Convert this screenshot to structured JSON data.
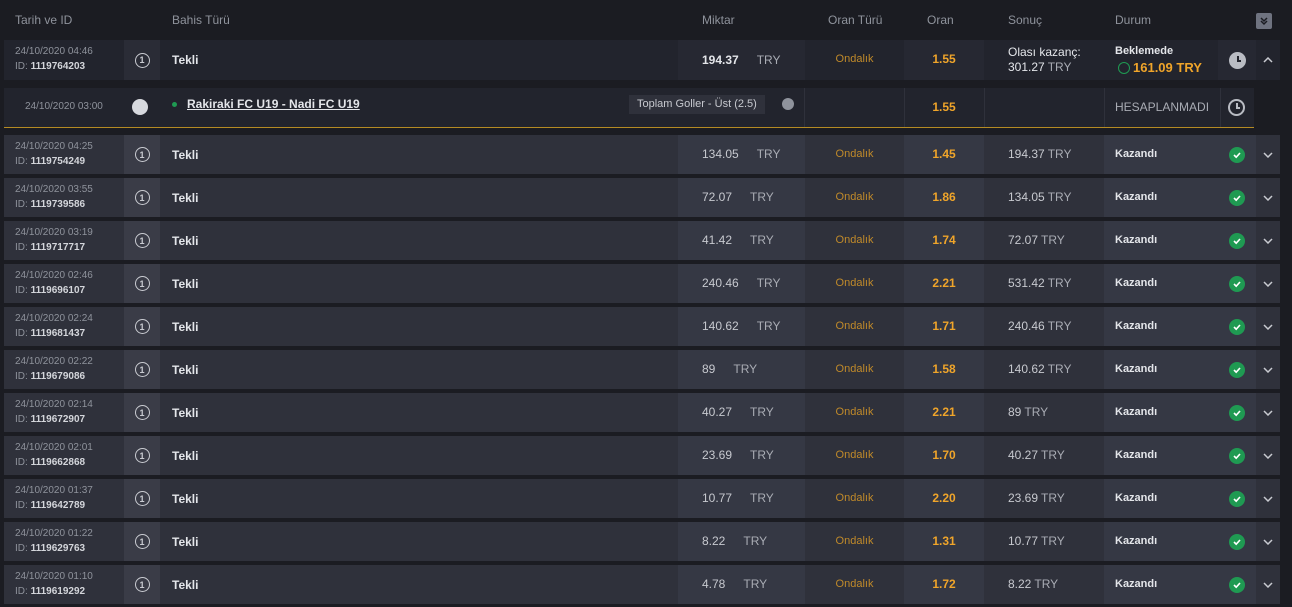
{
  "header": {
    "date_id": "Tarih ve ID",
    "bet_type": "Bahis Türü",
    "amount": "Miktar",
    "odds_type": "Oran Türü",
    "odds": "Oran",
    "result": "Sonuç",
    "status": "Durum"
  },
  "expanded_bet": {
    "date": "24/10/2020 04:46",
    "id_prefix": "ID:",
    "id": "1119764203",
    "type": "Tekli",
    "amount": "194.37",
    "currency": "TRY",
    "odds_type": "Ondalık",
    "odds": "1.55",
    "potential_label": "Olası kazanç:",
    "potential_amount": "301.27",
    "potential_currency": "TRY",
    "status": "Beklemede",
    "cashout": "161.09 TRY",
    "selection": {
      "date": "24/10/2020 03:00",
      "match": "Rakiraki FC U19 - Nadi FC U19",
      "market": "Toplam Goller - Üst (2.5)",
      "odds": "1.55",
      "status": "HESAPLANMADI"
    }
  },
  "bets": [
    {
      "date": "24/10/2020 04:25",
      "id": "1119754249",
      "type": "Tekli",
      "amount": "134.05",
      "currency": "TRY",
      "odds_type": "Ondalık",
      "odds": "1.45",
      "result": "194.37",
      "status": "Kazandı"
    },
    {
      "date": "24/10/2020 03:55",
      "id": "1119739586",
      "type": "Tekli",
      "amount": "72.07",
      "currency": "TRY",
      "odds_type": "Ondalık",
      "odds": "1.86",
      "result": "134.05",
      "status": "Kazandı"
    },
    {
      "date": "24/10/2020 03:19",
      "id": "1119717717",
      "type": "Tekli",
      "amount": "41.42",
      "currency": "TRY",
      "odds_type": "Ondalık",
      "odds": "1.74",
      "result": "72.07",
      "status": "Kazandı"
    },
    {
      "date": "24/10/2020 02:46",
      "id": "1119696107",
      "type": "Tekli",
      "amount": "240.46",
      "currency": "TRY",
      "odds_type": "Ondalık",
      "odds": "2.21",
      "result": "531.42",
      "status": "Kazandı"
    },
    {
      "date": "24/10/2020 02:24",
      "id": "1119681437",
      "type": "Tekli",
      "amount": "140.62",
      "currency": "TRY",
      "odds_type": "Ondalık",
      "odds": "1.71",
      "result": "240.46",
      "status": "Kazandı"
    },
    {
      "date": "24/10/2020 02:22",
      "id": "1119679086",
      "type": "Tekli",
      "amount": "89",
      "currency": "TRY",
      "odds_type": "Ondalık",
      "odds": "1.58",
      "result": "140.62",
      "status": "Kazandı"
    },
    {
      "date": "24/10/2020 02:14",
      "id": "1119672907",
      "type": "Tekli",
      "amount": "40.27",
      "currency": "TRY",
      "odds_type": "Ondalık",
      "odds": "2.21",
      "result": "89",
      "status": "Kazandı"
    },
    {
      "date": "24/10/2020 02:01",
      "id": "1119662868",
      "type": "Tekli",
      "amount": "23.69",
      "currency": "TRY",
      "odds_type": "Ondalık",
      "odds": "1.70",
      "result": "40.27",
      "status": "Kazandı"
    },
    {
      "date": "24/10/2020 01:37",
      "id": "1119642789",
      "type": "Tekli",
      "amount": "10.77",
      "currency": "TRY",
      "odds_type": "Ondalık",
      "odds": "2.20",
      "result": "23.69",
      "status": "Kazandı"
    },
    {
      "date": "24/10/2020 01:22",
      "id": "1119629763",
      "type": "Tekli",
      "amount": "8.22",
      "currency": "TRY",
      "odds_type": "Ondalık",
      "odds": "1.31",
      "result": "10.77",
      "status": "Kazandı"
    },
    {
      "date": "24/10/2020 01:10",
      "id": "1119619292",
      "type": "Tekli",
      "amount": "4.78",
      "currency": "TRY",
      "odds_type": "Ondalık",
      "odds": "1.72",
      "result": "8.22",
      "status": "Kazandı"
    }
  ],
  "type_icon_text": "1",
  "id_prefix": "ID:"
}
